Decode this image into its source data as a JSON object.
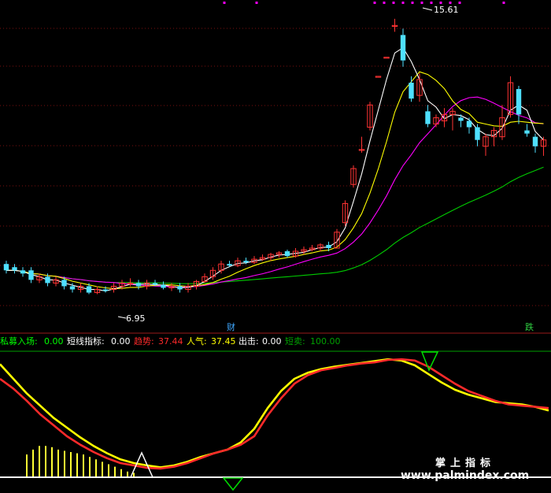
{
  "chart_data": [
    {
      "type": "candlestick",
      "title": "",
      "price_labels": {
        "high": "15.61",
        "low": "6.95"
      },
      "markers": [
        {
          "label": "财",
          "color": "#3fa7ff"
        },
        {
          "label": "跌",
          "color": "#2ecc40"
        }
      ],
      "series_colors": {
        "ma5": "#ffffff",
        "ma10": "#ffff00",
        "ma20": "#ff00ff",
        "ma60": "#00cc00"
      },
      "up_color": "#ff3333",
      "down_color": "#4fe0ff",
      "candles": [
        {
          "o": 7.9,
          "c": 7.7,
          "h": 8.0,
          "l": 7.6
        },
        {
          "o": 7.8,
          "c": 7.7,
          "h": 7.9,
          "l": 7.6
        },
        {
          "o": 7.7,
          "c": 7.6,
          "h": 7.8,
          "l": 7.5
        },
        {
          "o": 7.7,
          "c": 7.4,
          "h": 7.8,
          "l": 7.3
        },
        {
          "o": 7.4,
          "c": 7.5,
          "h": 7.6,
          "l": 7.3
        },
        {
          "o": 7.5,
          "c": 7.3,
          "h": 7.6,
          "l": 7.2
        },
        {
          "o": 7.3,
          "c": 7.4,
          "h": 7.5,
          "l": 7.2
        },
        {
          "o": 7.4,
          "c": 7.2,
          "h": 7.5,
          "l": 7.1
        },
        {
          "o": 7.2,
          "c": 7.1,
          "h": 7.3,
          "l": 7.0
        },
        {
          "o": 7.1,
          "c": 7.2,
          "h": 7.3,
          "l": 7.0
        },
        {
          "o": 7.2,
          "c": 7.0,
          "h": 7.3,
          "l": 6.95
        },
        {
          "o": 7.0,
          "c": 7.1,
          "h": 7.2,
          "l": 6.95
        },
        {
          "o": 7.1,
          "c": 7.05,
          "h": 7.2,
          "l": 7.0
        },
        {
          "o": 7.1,
          "c": 7.2,
          "h": 7.3,
          "l": 7.0
        },
        {
          "o": 7.2,
          "c": 7.3,
          "h": 7.4,
          "l": 7.1
        },
        {
          "o": 7.3,
          "c": 7.3,
          "h": 7.45,
          "l": 7.2
        },
        {
          "o": 7.3,
          "c": 7.2,
          "h": 7.4,
          "l": 7.1
        },
        {
          "o": 7.2,
          "c": 7.3,
          "h": 7.4,
          "l": 7.1
        },
        {
          "o": 7.3,
          "c": 7.25,
          "h": 7.4,
          "l": 7.2
        },
        {
          "o": 7.25,
          "c": 7.15,
          "h": 7.35,
          "l": 7.1
        },
        {
          "o": 7.15,
          "c": 7.2,
          "h": 7.3,
          "l": 7.05
        },
        {
          "o": 7.2,
          "c": 7.1,
          "h": 7.3,
          "l": 7.0
        },
        {
          "o": 7.1,
          "c": 7.2,
          "h": 7.3,
          "l": 7.0
        },
        {
          "o": 7.2,
          "c": 7.35,
          "h": 7.4,
          "l": 7.1
        },
        {
          "o": 7.35,
          "c": 7.5,
          "h": 7.6,
          "l": 7.3
        },
        {
          "o": 7.5,
          "c": 7.7,
          "h": 7.8,
          "l": 7.4
        },
        {
          "o": 7.7,
          "c": 7.9,
          "h": 8.0,
          "l": 7.6
        },
        {
          "o": 7.9,
          "c": 7.85,
          "h": 8.0,
          "l": 7.8
        },
        {
          "o": 7.85,
          "c": 8.0,
          "h": 8.1,
          "l": 7.8
        },
        {
          "o": 8.0,
          "c": 7.95,
          "h": 8.1,
          "l": 7.9
        },
        {
          "o": 7.95,
          "c": 8.05,
          "h": 8.15,
          "l": 7.9
        },
        {
          "o": 8.05,
          "c": 8.1,
          "h": 8.2,
          "l": 8.0
        },
        {
          "o": 8.1,
          "c": 8.2,
          "h": 8.25,
          "l": 8.0
        },
        {
          "o": 8.2,
          "c": 8.25,
          "h": 8.3,
          "l": 8.1
        },
        {
          "o": 8.3,
          "c": 8.15,
          "h": 8.35,
          "l": 8.1
        },
        {
          "o": 8.15,
          "c": 8.3,
          "h": 8.4,
          "l": 8.1
        },
        {
          "o": 8.3,
          "c": 8.35,
          "h": 8.45,
          "l": 8.2
        },
        {
          "o": 8.35,
          "c": 8.4,
          "h": 8.5,
          "l": 8.3
        },
        {
          "o": 8.4,
          "c": 8.5,
          "h": 8.55,
          "l": 8.3
        },
        {
          "o": 8.5,
          "c": 8.4,
          "h": 8.6,
          "l": 8.3
        },
        {
          "o": 8.4,
          "c": 8.9,
          "h": 9.0,
          "l": 8.4
        },
        {
          "o": 9.2,
          "c": 9.8,
          "h": 9.9,
          "l": 9.1
        },
        {
          "o": 10.4,
          "c": 10.9,
          "h": 11.0,
          "l": 10.3
        },
        {
          "o": 11.5,
          "c": 11.5,
          "h": 11.9,
          "l": 11.4
        },
        {
          "o": 12.2,
          "c": 12.9,
          "h": 13.0,
          "l": 12.1
        },
        {
          "o": 13.8,
          "c": 13.8,
          "h": 13.8,
          "l": 13.8
        },
        {
          "o": 14.4,
          "c": 14.4,
          "h": 14.4,
          "l": 14.4
        },
        {
          "o": 15.4,
          "c": 15.4,
          "h": 15.61,
          "l": 15.2
        },
        {
          "o": 15.1,
          "c": 14.3,
          "h": 15.3,
          "l": 14.1
        },
        {
          "o": 13.6,
          "c": 13.1,
          "h": 13.8,
          "l": 13.0
        },
        {
          "o": 13.2,
          "c": 13.7,
          "h": 13.9,
          "l": 13.0
        },
        {
          "o": 12.7,
          "c": 12.3,
          "h": 12.9,
          "l": 12.2
        },
        {
          "o": 12.3,
          "c": 12.5,
          "h": 12.6,
          "l": 12.2
        },
        {
          "o": 12.4,
          "c": 12.6,
          "h": 12.8,
          "l": 12.2
        },
        {
          "o": 12.6,
          "c": 12.7,
          "h": 12.8,
          "l": 12.1
        },
        {
          "o": 12.5,
          "c": 12.4,
          "h": 12.6,
          "l": 12.2
        },
        {
          "o": 12.4,
          "c": 12.2,
          "h": 12.5,
          "l": 12.0
        },
        {
          "o": 12.2,
          "c": 11.8,
          "h": 12.3,
          "l": 11.6
        },
        {
          "o": 11.6,
          "c": 11.9,
          "h": 12.0,
          "l": 11.3
        },
        {
          "o": 11.9,
          "c": 12.1,
          "h": 12.2,
          "l": 11.6
        },
        {
          "o": 11.9,
          "c": 12.5,
          "h": 12.9,
          "l": 11.8
        },
        {
          "o": 12.6,
          "c": 13.6,
          "h": 13.8,
          "l": 12.5
        },
        {
          "o": 13.4,
          "c": 12.6,
          "h": 13.5,
          "l": 12.3
        },
        {
          "o": 12.1,
          "c": 12.0,
          "h": 12.3,
          "l": 11.9
        },
        {
          "o": 11.9,
          "c": 11.6,
          "h": 12.0,
          "l": 11.4
        },
        {
          "o": 11.6,
          "c": 11.8,
          "h": 11.9,
          "l": 11.3
        }
      ]
    },
    {
      "type": "line",
      "title": "",
      "legend": [
        {
          "label": "私募入场:",
          "value": "0.00",
          "color": "#00ff00"
        },
        {
          "label": "短线指标:",
          "value": "0.00",
          "color": "#ffffff"
        },
        {
          "label": "趋势:",
          "value": "37.44",
          "color": "#ff2a2a"
        },
        {
          "label": "人气:",
          "value": "37.45",
          "color": "#ffff00"
        },
        {
          "label": "出击:",
          "value": "0.00",
          "color": "#ffffff"
        },
        {
          "label": "短卖:",
          "value": "100.00",
          "color": "#00a000"
        }
      ],
      "ylim": [
        0,
        100
      ],
      "series": [
        {
          "name": "趋势",
          "color": "#ff2a2a",
          "values": [
            80,
            72,
            62,
            51,
            42,
            33,
            26,
            20,
            15,
            11,
            9,
            7,
            6.5,
            8,
            11,
            15,
            19,
            22,
            26,
            33,
            50,
            64,
            76,
            83,
            87,
            89,
            91,
            92.5,
            93.5,
            95.5,
            96,
            95,
            90,
            83,
            76,
            70,
            66,
            62,
            59,
            58,
            57,
            56
          ]
        },
        {
          "name": "人气",
          "color": "#ffff00",
          "values": [
            92,
            80,
            68,
            58,
            48,
            40,
            32,
            25,
            19,
            14,
            11,
            9,
            7.5,
            9,
            12,
            16,
            19,
            22,
            28,
            39,
            56,
            70,
            80,
            85,
            88,
            90,
            91.5,
            93,
            94.5,
            96,
            95,
            91,
            84,
            77,
            71,
            67,
            64,
            61,
            60,
            59,
            57,
            54
          ]
        }
      ],
      "bars": [
        18,
        22,
        25,
        25,
        24,
        22,
        21,
        20,
        19,
        18,
        16,
        14,
        12,
        10,
        8,
        6,
        4,
        3
      ],
      "extra_labels": [
        "掌上指标",
        "www.palmindex.com"
      ]
    }
  ]
}
